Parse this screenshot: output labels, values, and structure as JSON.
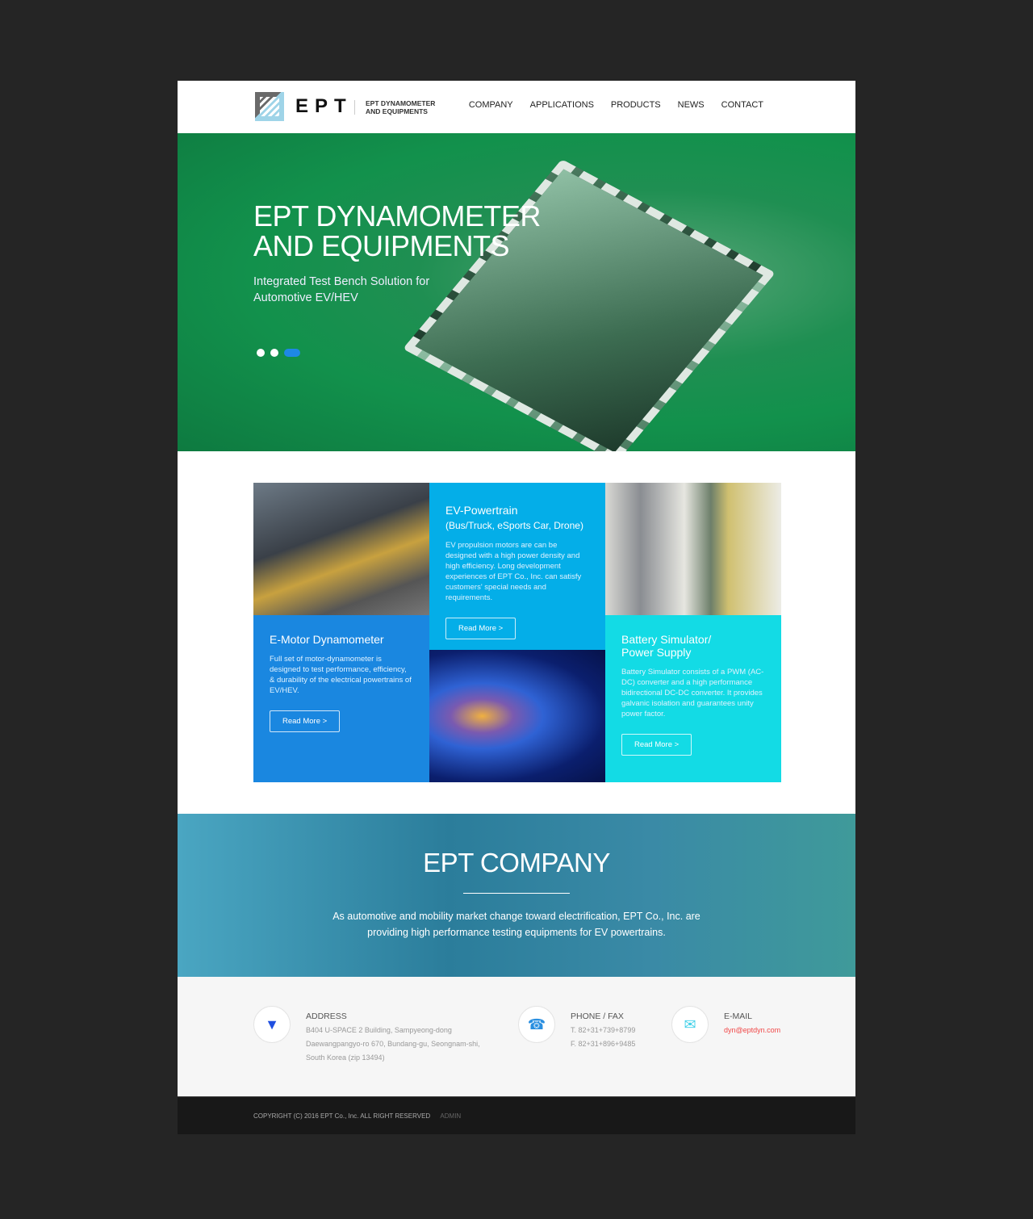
{
  "header": {
    "brand": "EPT",
    "tagline_1": "EPT DYNAMOMETER",
    "tagline_2": "AND EQUIPMENTS",
    "nav": [
      "COMPANY",
      "APPLICATIONS",
      "PRODUCTS",
      "NEWS",
      "CONTACT"
    ]
  },
  "hero": {
    "title_1": "EPT DYNAMOMETER",
    "title_2": "AND EQUIPMENTS",
    "subtitle_1": "Integrated Test Bench Solution for",
    "subtitle_2": "Automotive EV/HEV",
    "slides": 3,
    "active_slide": 3
  },
  "cards": [
    {
      "title": "E-Motor Dynamometer",
      "desc": "Full set of motor-dynamometer is designed to test performance, efficiency, & durability of the electrical powertrains of EV/HEV.",
      "button": "Read More >",
      "color": "#1a87e0"
    },
    {
      "title": "EV-Powertrain",
      "title_2": "(Bus/Truck, eSports Car, Drone)",
      "desc": "EV propulsion motors are can be designed with a high power density and high efficiency. Long development experiences of EPT Co., Inc. can satisfy customers' special needs and requirements.",
      "button": "Read More >",
      "color": "#04aee8"
    },
    {
      "title": "Battery Simulator/",
      "title_2": "Power Supply",
      "desc": "Battery Simulator consists of a PWM (AC-DC) converter and a high performance bidirectional DC-DC converter. It provides galvanic isolation and guarantees unity power factor.",
      "button": "Read More >",
      "color": "#13dbe5"
    }
  ],
  "company": {
    "title": "EPT COMPANY",
    "text_1": "As automotive and mobility market change toward electrification, EPT Co., Inc. are",
    "text_2": "providing high performance testing equipments for EV powertrains."
  },
  "contact": {
    "address": {
      "label": "ADDRESS",
      "lines": [
        "B404 U-SPACE 2 Building, Sampyeong-dong",
        "Daewangpangyo-ro 670, Bundang-gu, Seongnam-shi,",
        "South Korea (zip 13494)"
      ],
      "icon": "map-pin-icon"
    },
    "phone": {
      "label": "PHONE / FAX",
      "lines": [
        "T. 82+31+739+8799",
        "F. 82+31+896+9485"
      ],
      "icon": "phone-icon"
    },
    "email": {
      "label": "E-MAIL",
      "value": "dyn@eptdyn.com",
      "icon": "envelope-icon"
    }
  },
  "footer": {
    "copyright": "COPYRIGHT (C) 2016 EPT Co., Inc. ALL RIGHT RESERVED",
    "admin": "ADMIN"
  }
}
